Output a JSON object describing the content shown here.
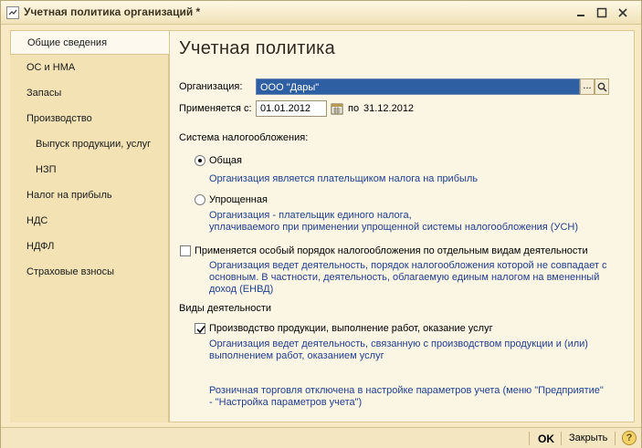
{
  "window": {
    "title": "Учетная политика организаций *"
  },
  "nav": {
    "items": [
      {
        "label": "Общие сведения"
      },
      {
        "label": "ОС и НМА"
      },
      {
        "label": "Запасы"
      },
      {
        "label": "Производство"
      },
      {
        "label": "Выпуск продукции, услуг"
      },
      {
        "label": "НЗП"
      },
      {
        "label": "Налог на прибыль"
      },
      {
        "label": "НДС"
      },
      {
        "label": "НДФЛ"
      },
      {
        "label": "Страховые взносы"
      }
    ]
  },
  "main": {
    "title": "Учетная политика",
    "org_label": "Организация:",
    "org_value": "ООО \"Дары\"",
    "dots_label": "...",
    "applied_label": "Применяется с:",
    "date_from": "01.01.2012",
    "date_to_label": "по",
    "date_to": "31.12.2012",
    "tax_system_label": "Система налогообложения:",
    "radio_general": "Общая",
    "radio_general_desc": "Организация является плательщиком налога на прибыль",
    "radio_simplified": "Упрощенная",
    "radio_simplified_desc_1": "Организация - плательщик единого налога,",
    "radio_simplified_desc_2": "уплачиваемого при применении упрощенной системы налогообложения (УСН)",
    "special_order_label": "Применяется особый порядок налогообложения по отдельным видам деятельности",
    "special_order_desc_1": "Организация ведет деятельность, порядок налогообложения которой не совпадает с",
    "special_order_desc_2": "основным. В частности, деятельность, облагаемую единым налогом на вмененный",
    "special_order_desc_3": "доход (ЕНВД)",
    "activities_label": "Виды деятельности",
    "production_label": "Производство  продукции, выполнение работ, оказание услуг",
    "production_desc_1": "Организация ведет деятельность, связанную с производством продукции и (или)",
    "production_desc_2": "выполнением работ, оказанием услуг",
    "retail_note_1": "Розничная торговля отключена в настройке параметров учета (меню \"Предприятие\"",
    "retail_note_2": "- \"Настройка параметров учета\")"
  },
  "bottom": {
    "ok_label": "OK",
    "close_label": "Закрыть",
    "help_label": "?"
  }
}
